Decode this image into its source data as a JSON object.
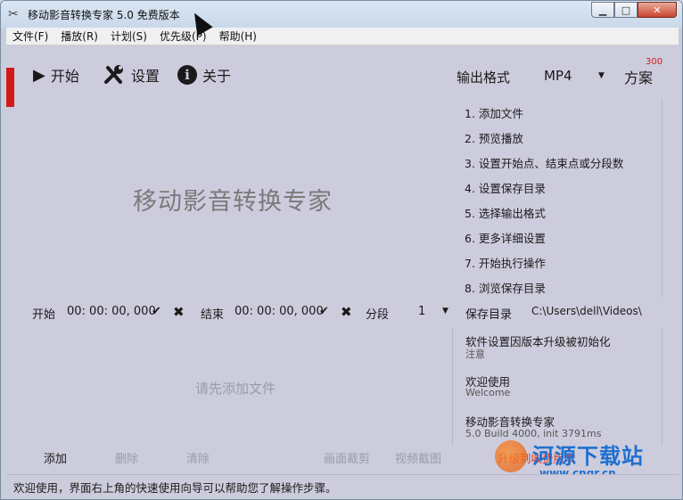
{
  "window": {
    "title": "移动影音转换专家 5.0 免费版本",
    "app_icon": "scissors-icon",
    "minimize_glyph": "▁",
    "maximize_glyph": "□",
    "close_glyph": "✕"
  },
  "menubar": {
    "items": [
      "文件(F)",
      "播放(R)",
      "计划(S)",
      "优先级(P)",
      "帮助(H)"
    ]
  },
  "toolbar": {
    "start_label": "开始",
    "settings_label": "设置",
    "about_label": "关于",
    "output_format_label": "输出格式",
    "output_format_value": "MP4",
    "scheme_label": "方案",
    "scheme_badge": "300"
  },
  "main": {
    "brand_text": "移动影音转换专家",
    "empty_placeholder": "请先添加文件"
  },
  "steps": [
    "1. 添加文件",
    "2. 预览播放",
    "3. 设置开始点、结束点或分段数",
    "4. 设置保存目录",
    "5. 选择输出格式",
    "6. 更多详细设置",
    "7. 开始执行操作",
    "8. 浏览保存目录"
  ],
  "timeline": {
    "start_label": "开始",
    "start_time": "00: 00: 00, 000",
    "end_label": "结束",
    "end_time": "00: 00: 00, 000",
    "segment_label": "分段",
    "segment_value": "1",
    "save_dir_label": "保存目录",
    "save_dir_value": "C:\\Users\\dell\\Videos\\"
  },
  "info": [
    {
      "title": "软件设置因版本升级被初始化",
      "subtitle": "注意"
    },
    {
      "title": "欢迎使用",
      "subtitle": "Welcome"
    },
    {
      "title": "移动影音转换专家",
      "subtitle": "5.0 Build 4000, init 3791ms"
    }
  ],
  "bottom_buttons": {
    "add": "添加",
    "delete": "删除",
    "clear": "清除",
    "crop": "画面裁剪",
    "screenshot": "视频截图"
  },
  "promo_text": "升级到收费版本",
  "watermark": {
    "title": "河源下载站",
    "url": "www.cngr.cn"
  },
  "status": {
    "text": "欢迎使用，界面右上角的快速使用向导可以帮助您了解操作步骤。"
  },
  "colors": {
    "accent_red": "#d31a1a",
    "client_bg": "#ccccdd",
    "watermark_blue": "#1f6fd0"
  }
}
